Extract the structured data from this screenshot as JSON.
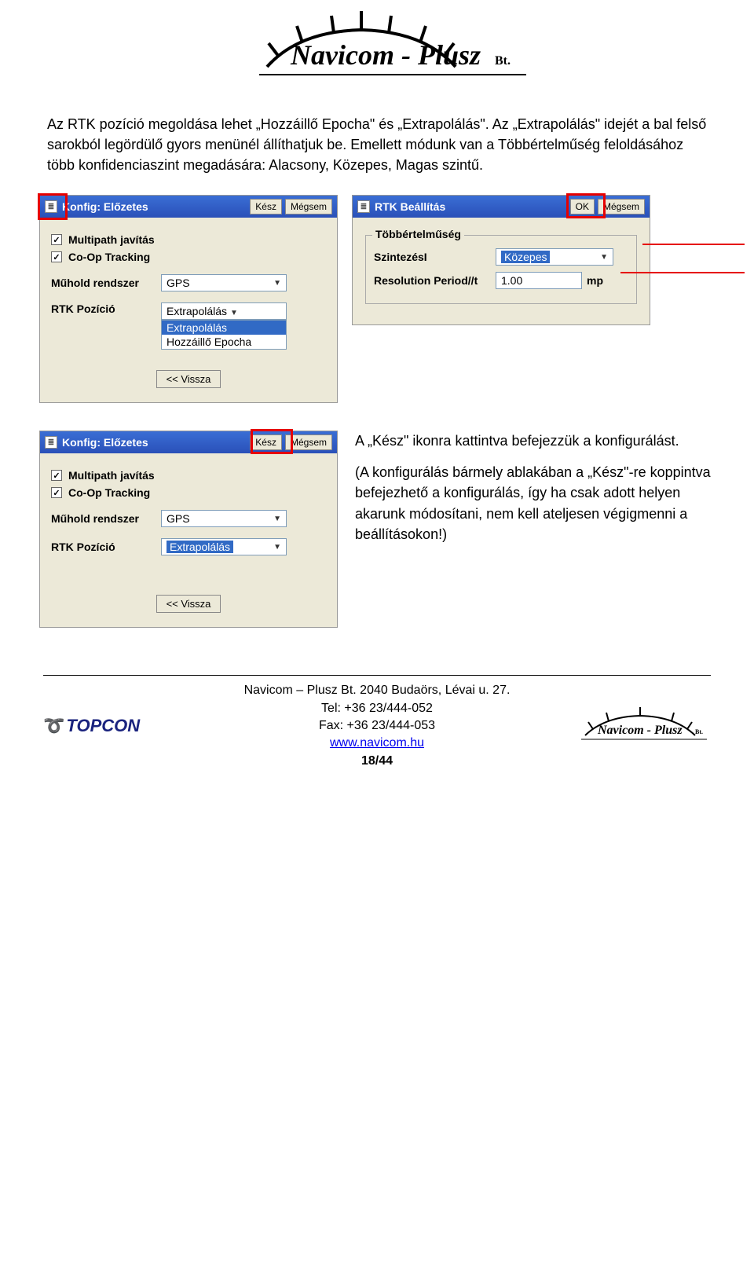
{
  "header": {
    "logo_text": "Navicom - Plusz",
    "logo_suffix": "Bt."
  },
  "intro": {
    "p1": "Az RTK pozíció megoldása lehet „Hozzáillő Epocha\" és „Extrapolálás\". Az „Extrapolálás\" idejét a bal felső sarokból legördülő gyors menünél állíthatjuk be. Emellett módunk van a Többértelműség feloldásához több konfidenciaszint megadására: Alacsony, Közepes, Magas szintű."
  },
  "panel1": {
    "title": "Konfig: Előzetes",
    "btn_done": "Kész",
    "btn_cancel": "Mégsem",
    "chk_multipath": "Multipath javítás",
    "chk_coop": "Co-Op Tracking",
    "lbl_satsys": "Műhold rendszer",
    "val_satsys": "GPS",
    "lbl_rtkpos": "RTK Pozíció",
    "val_rtkpos": "Extrapolálás",
    "list_extrapol": "Extrapolálás",
    "list_epoch": "Hozzáillő Epocha",
    "btn_back": "<< Vissza"
  },
  "panel2": {
    "title": "RTK Beállítás",
    "btn_ok": "OK",
    "btn_cancel": "Mégsem",
    "group_title": "Többértelműség",
    "lbl_level": "SzintezésI",
    "val_level": "Közepes",
    "lbl_resperiod": "Resolution Period//t",
    "val_resperiod": "1.00",
    "unit_resperiod": "mp"
  },
  "panel3": {
    "title": "Konfig: Előzetes",
    "btn_done": "Kész",
    "btn_cancel": "Mégsem",
    "chk_multipath": "Multipath javítás",
    "chk_coop": "Co-Op Tracking",
    "lbl_satsys": "Műhold rendszer",
    "val_satsys": "GPS",
    "lbl_rtkpos": "RTK Pozíció",
    "val_rtkpos": "Extrapolálás",
    "btn_back": "<< Vissza"
  },
  "side": {
    "p1": "A „Kész\" ikonra kattintva befejezzük a konfigurálást.",
    "p2": "(A konfigurálás bármely ablakában a „Kész\"-re koppintva befejezhető a konfigurálás, így ha csak adott helyen akarunk módosítani, nem kell ateljesen végigmenni a beállításokon!)"
  },
  "footer": {
    "topcon": "TOPCON",
    "line1": "Navicom – Plusz Bt. 2040 Budaörs, Lévai u. 27.",
    "line2": "Tel: +36 23/444-052",
    "line3": "Fax: +36 23/444-053",
    "link": "www.navicom.hu",
    "page": "18/44",
    "logo_text": "Navicom - Plusz",
    "logo_suffix": "Bt."
  }
}
